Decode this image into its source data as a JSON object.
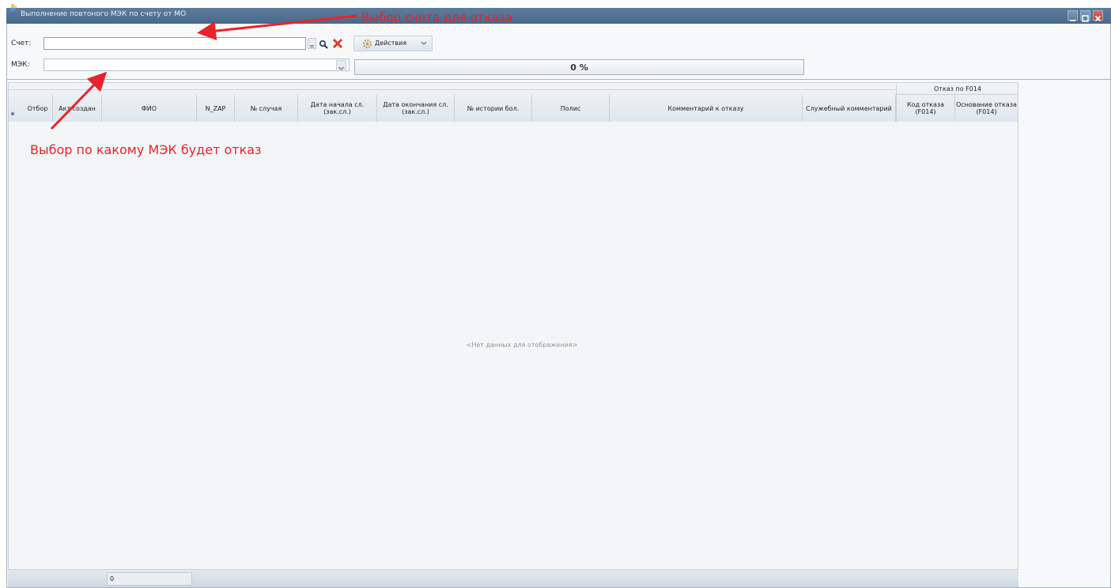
{
  "window": {
    "title": "Выполнение повтоного МЭК по счету от МО"
  },
  "filters": {
    "account_label": "Счет:",
    "account_value": "",
    "mek_label": "МЭК:",
    "mek_value": ""
  },
  "toolbar": {
    "actions_label": "Действия"
  },
  "progress": {
    "text": "0 %",
    "value": 0
  },
  "grid": {
    "group_header": "Отказ по F014",
    "columns": [
      "Отбор",
      "Акт создан",
      "ФИО",
      "N_ZAP",
      "№ случая",
      "Дата начала сл. (зак.сл.)",
      "Дата окончания сл. (зак.сл.)",
      "№ истории бол.",
      "Полис",
      "Комментарий к отказу",
      "Служебный комментарий",
      "Код отказа (F014)",
      "Основание отказа (F014)"
    ],
    "empty_text": "<Нет данных для отображения>"
  },
  "footer": {
    "count": "0"
  },
  "annotations": {
    "account": "Выбор счета для отказа",
    "mek": "Выбор по какому МЭК будет отказ"
  },
  "colors": {
    "annotation": "#e8232a",
    "titlebar": "#4f6f90"
  },
  "icons": [
    "app-icon",
    "minimize-icon",
    "maximize-icon",
    "close-icon",
    "search-icon",
    "clear-icon",
    "gear-icon",
    "chevron-down-icon"
  ]
}
